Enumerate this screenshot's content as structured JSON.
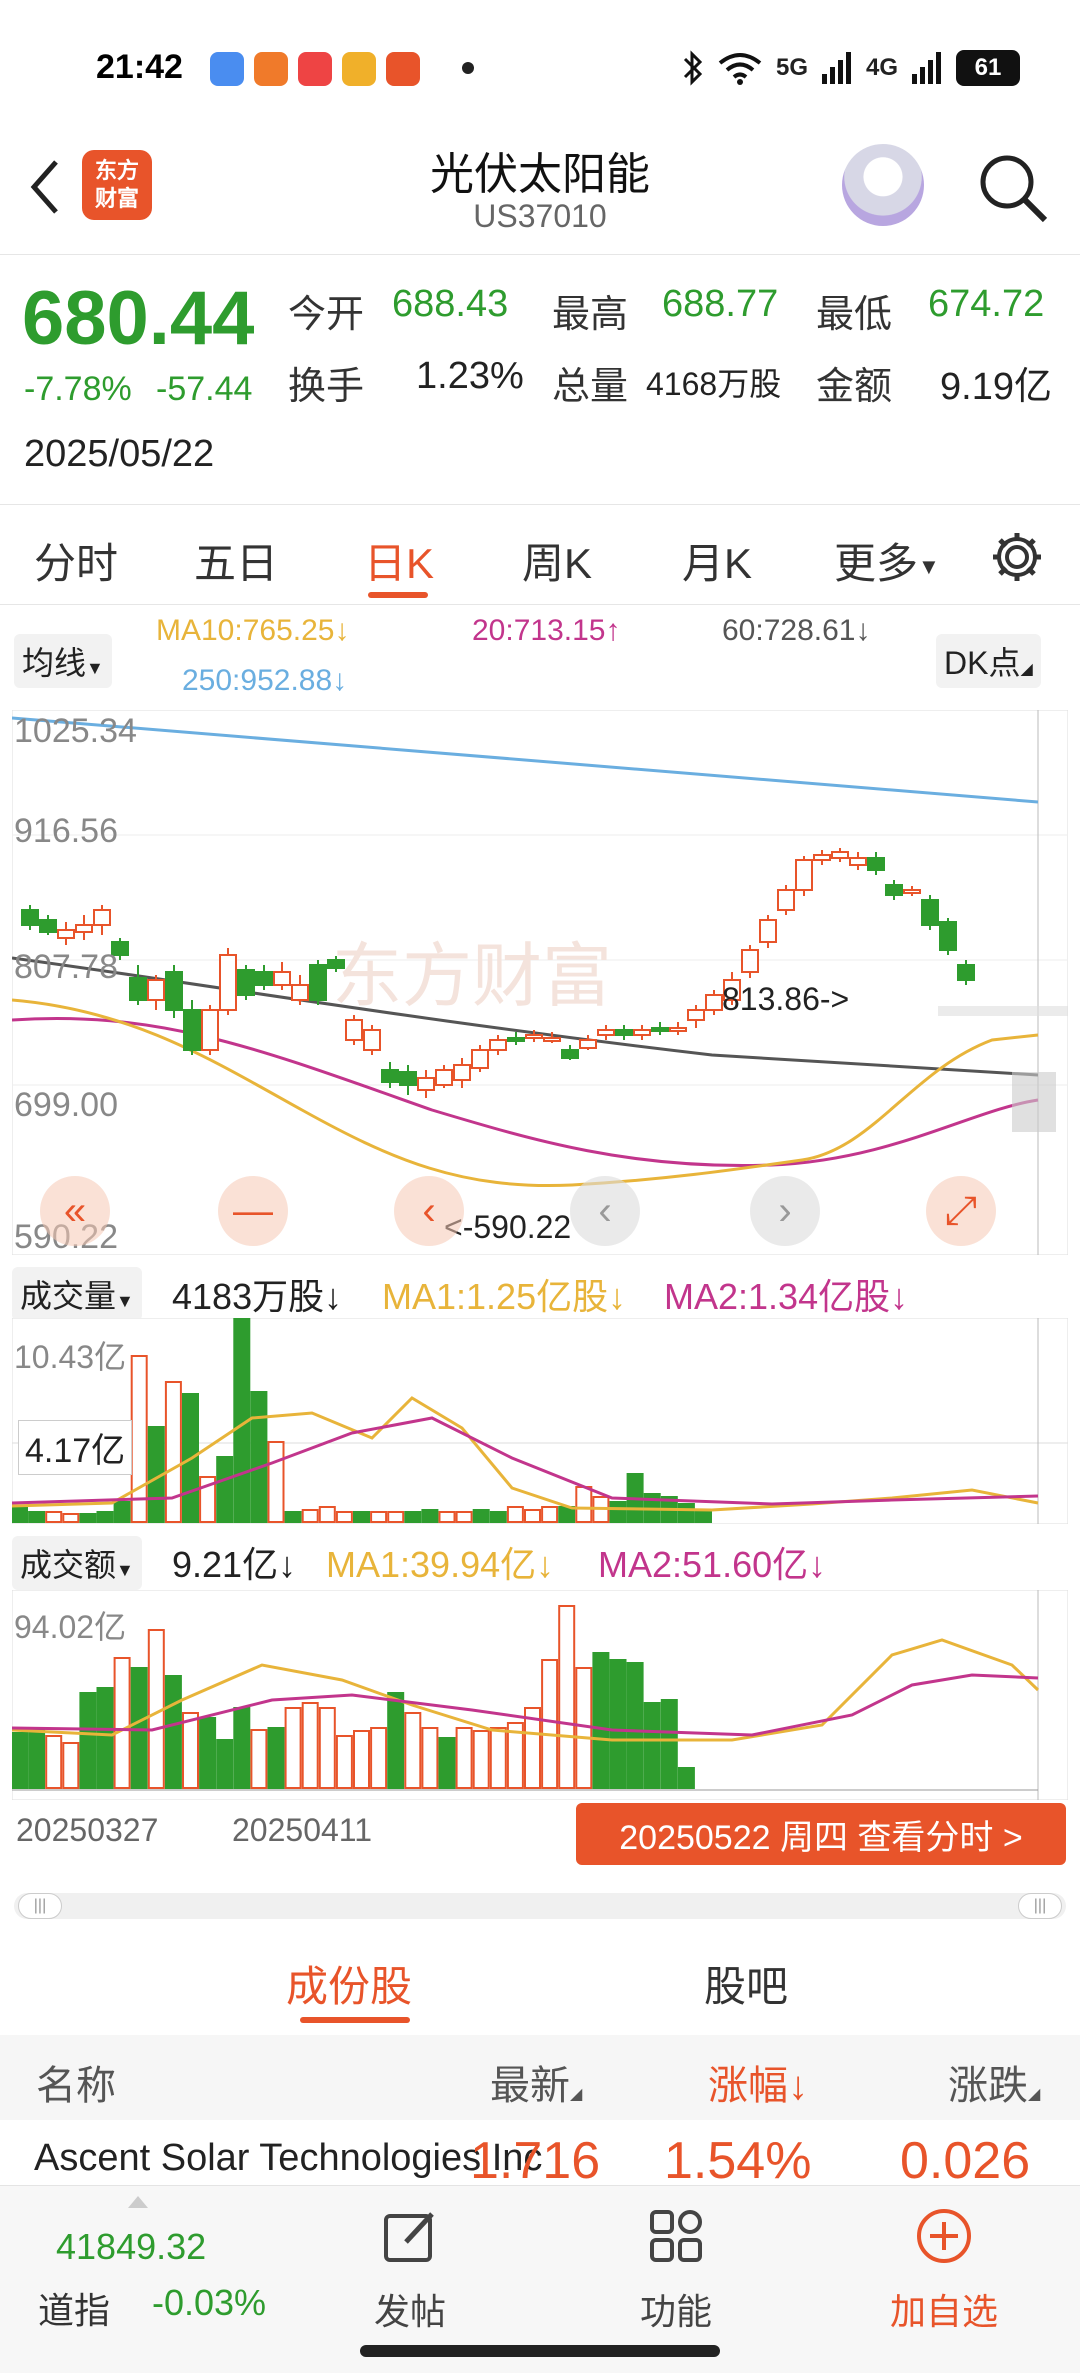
{
  "status": {
    "time": "21:42",
    "battery": "61",
    "net1": "5G",
    "net2": "4G"
  },
  "header": {
    "title": "光伏太阳能",
    "code": "US37010",
    "logo_text": "东方\n财富"
  },
  "quote": {
    "price": "680.44",
    "change_pct": "-7.78%",
    "change": "-57.44",
    "date": "2025/05/22",
    "open_label": "今开",
    "open": "688.43",
    "high_label": "最高",
    "high": "688.77",
    "low_label": "最低",
    "low": "674.72",
    "turnover_label": "换手",
    "turnover": "1.23%",
    "volume_label": "总量",
    "volume": "4168万股",
    "amount_label": "金额",
    "amount": "9.19亿"
  },
  "tabs": [
    "分时",
    "五日",
    "日K",
    "周K",
    "月K",
    "更多"
  ],
  "ma": {
    "selector": "均线",
    "ma10": "MA10:765.25↓",
    "ma20": "20:713.15↑",
    "ma60": "60:728.61↓",
    "ma250": "250:952.88↓",
    "dk": "DK点"
  },
  "kline": {
    "y_labels": [
      "1025.34",
      "916.56",
      "807.78",
      "699.00",
      "590.22"
    ],
    "high_annot": "813.86->",
    "low_annot": "<-590.22",
    "watermark": "东方财富"
  },
  "volume": {
    "selector": "成交量",
    "value": "4183万股↓",
    "ma1": "MA1:1.25亿股↓",
    "ma2": "MA2:1.34亿股↓",
    "max_label": "10.43亿",
    "mid_label": "4.17亿"
  },
  "amount": {
    "selector": "成交额",
    "value": "9.21亿↓",
    "ma1": "MA1:39.94亿↓",
    "ma2": "MA2:51.60亿↓",
    "max_label": "94.02亿"
  },
  "dates": {
    "d1": "20250327",
    "d2": "20250411"
  },
  "timeshare_btn": "20250522 周四 查看分时 >",
  "subtabs": [
    "成份股",
    "股吧"
  ],
  "table": {
    "headers": {
      "name": "名称",
      "latest": "最新",
      "pct": "涨幅",
      "chg": "涨跌"
    },
    "row": {
      "name": "Ascent Solar Technologies Inc",
      "latest": "1.716",
      "pct": "1.54%",
      "chg": "0.026"
    }
  },
  "bottom": {
    "index_value": "41849.32",
    "index_name": "道指",
    "index_chg": "-0.03%",
    "post": "发帖",
    "func": "功能",
    "add": "加自选"
  },
  "colors": {
    "up": "#e8542a",
    "down": "#2e9c2e",
    "accent": "#e8542a"
  }
}
